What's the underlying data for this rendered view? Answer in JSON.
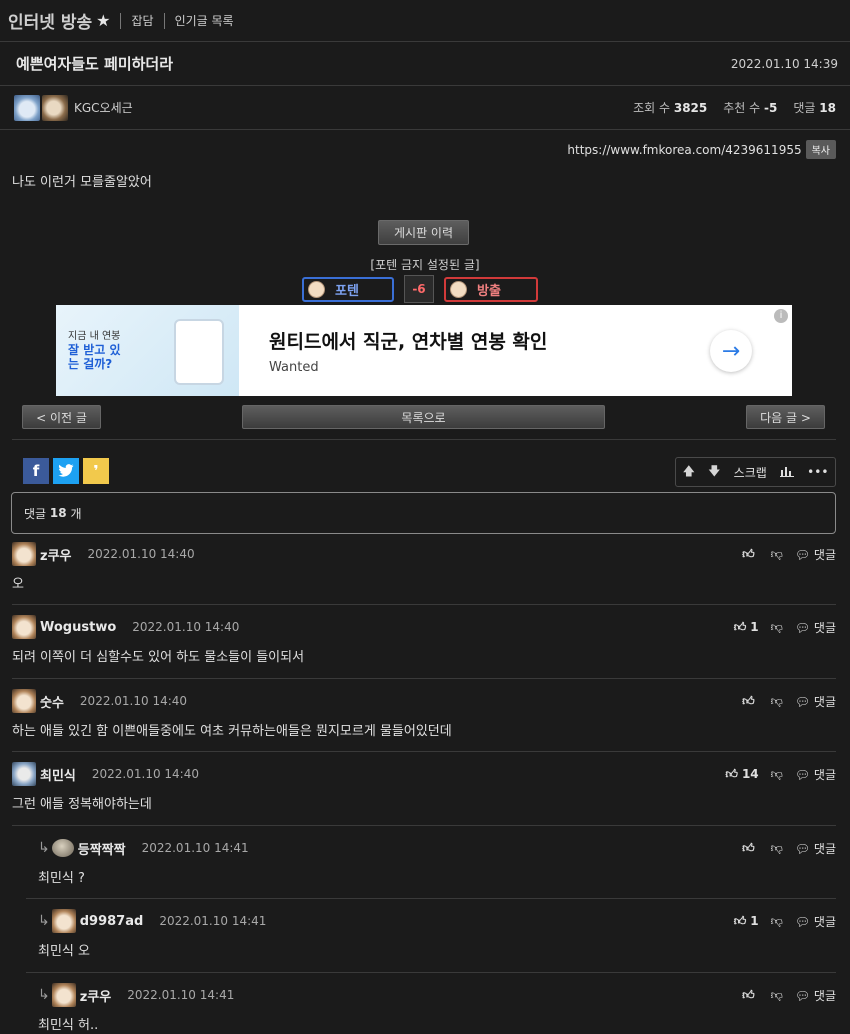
{
  "header": {
    "board": "인터넷 방송",
    "links": [
      "잡담",
      "인기글 목록"
    ]
  },
  "post": {
    "title": "예쁜여자들도 페미하더라",
    "date": "2022.01.10 14:39",
    "author": "KGC오세근",
    "views_label": "조회 수",
    "views": "3825",
    "recommend_label": "추천 수",
    "recommend": "-5",
    "comments_label": "댓글",
    "comments": "18",
    "url": "https://www.fmkorea.com/4239611955",
    "copy_label": "복사",
    "body": "나도 이런거 모를줄알았어"
  },
  "history_button": "게시판 이력",
  "notice": "[포텐 금지 설정된 글]",
  "vote": {
    "up_label": "포텐",
    "count": "-6",
    "down_label": "방출"
  },
  "ad": {
    "small1": "지금 내 연봉",
    "small2": "잘 받고 있는 걸까?",
    "headline": "원티드에서 직군, 연차별 연봉 확인",
    "brand": "Wanted",
    "arrow": "→",
    "info": "i"
  },
  "nav": {
    "prev": "< 이전 글",
    "list": "목록으로",
    "next": "다음 글 >"
  },
  "share": {
    "fb": "f",
    "kakao": "❜"
  },
  "toolbar": {
    "up": "🡅",
    "down": "🡇",
    "scrap": "스크랩",
    "chart": "📊",
    "more": "•••"
  },
  "comment_count_prefix": "댓글",
  "comment_count": "18",
  "comment_count_suffix": "개",
  "comments": [
    {
      "name": "z쿠우",
      "date": "2022.01.10 14:40",
      "text": "오",
      "likes": "",
      "reply": "댓글"
    },
    {
      "name": "Wogustwo",
      "date": "2022.01.10 14:40",
      "text": "되려 이쪽이 더 심할수도 있어 하도 물소들이 들이되서",
      "likes": "1",
      "reply": "댓글"
    },
    {
      "name": "숫수",
      "date": "2022.01.10 14:40",
      "text": "하는 애들 있긴 함 이쁜애들중에도 여초 커뮤하는애들은 뭔지모르게 물들어있던데",
      "likes": "",
      "reply": "댓글"
    },
    {
      "name": "최민식",
      "date": "2022.01.10 14:40",
      "text": "그런 애들 정복해야하는데",
      "likes": "14",
      "reply": "댓글"
    },
    {
      "name": "등짝짝짝",
      "date": "2022.01.10 14:41",
      "text": "최민식 ?",
      "likes": "",
      "reply": "댓글"
    },
    {
      "name": "d9987ad",
      "date": "2022.01.10 14:41",
      "text": "최민식 오",
      "likes": "1",
      "reply": "댓글"
    },
    {
      "name": "z쿠우",
      "date": "2022.01.10 14:41",
      "text": "최민식 허..",
      "likes": "",
      "reply": "댓글"
    }
  ]
}
